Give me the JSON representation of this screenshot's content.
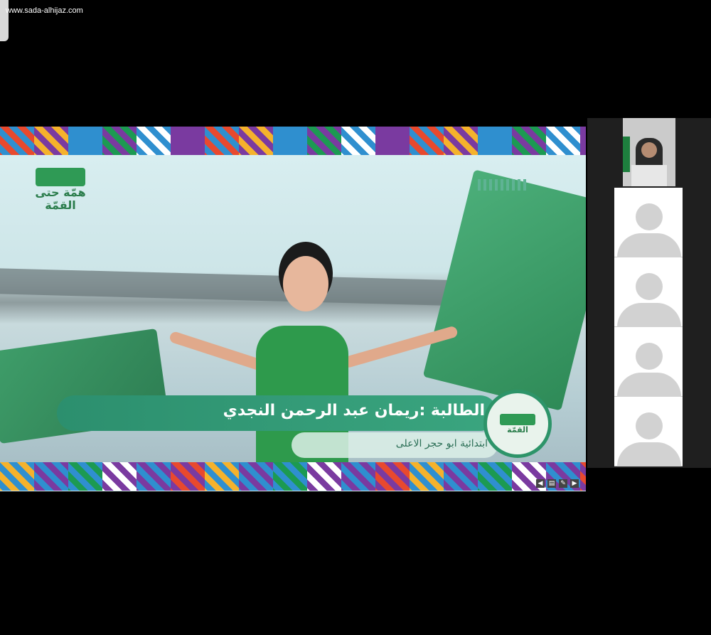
{
  "watermark": "www.sada-alhijaz.com",
  "border_colors": [
    "#e8492e",
    "#f5b22c",
    "#2f8fcf",
    "#1c9a52",
    "#ffffff",
    "#7a3aa0"
  ],
  "slide": {
    "student_label": "الطالبة :ريمان عبد الرحمن النجدي",
    "school_label": "ابتدائية ابو حجر الاعلى",
    "logo_left_text": "همّة حتى القمّة",
    "badge_text": "القمّة"
  },
  "participants": {
    "count_tiles": 4
  }
}
